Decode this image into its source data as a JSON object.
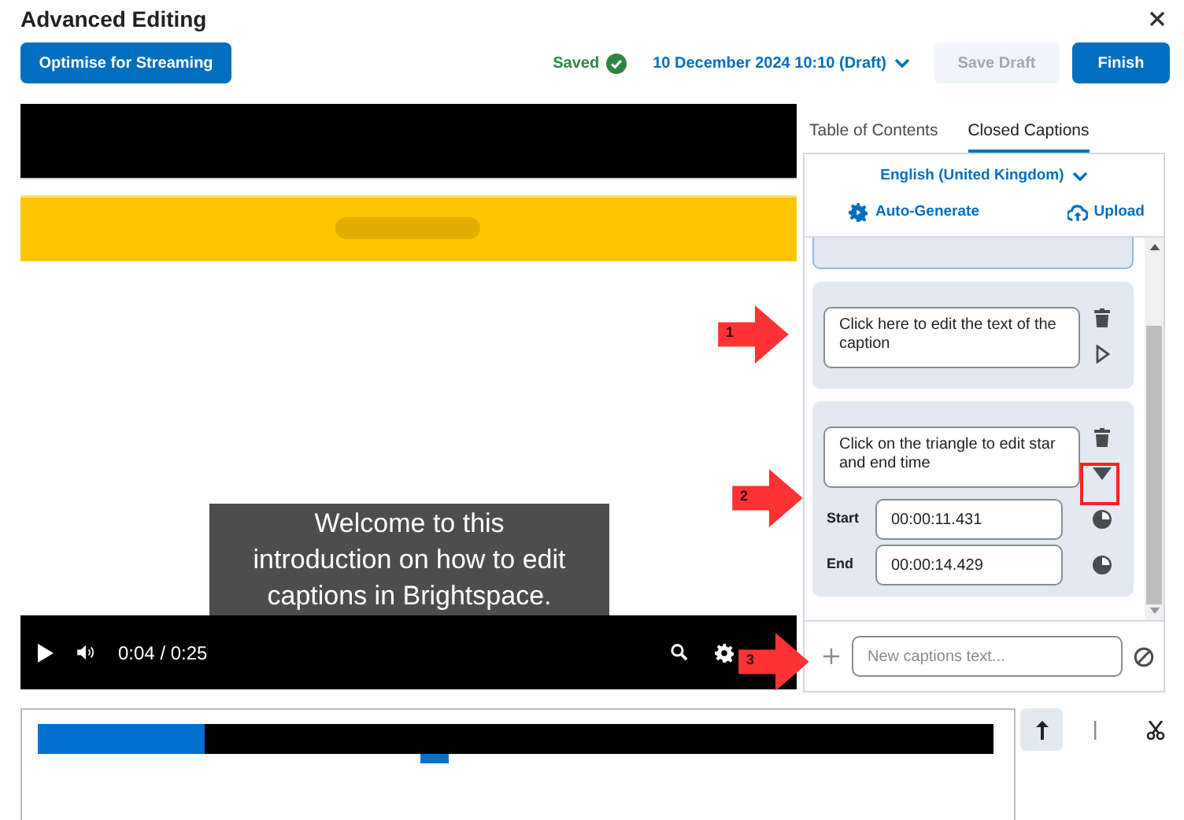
{
  "window": {
    "title": "Advanced Editing"
  },
  "toolbar": {
    "optimise_button": "Optimise for Streaming",
    "save_status": "Saved",
    "revision": "10 December 2024 10:10 (Draft)",
    "save_draft": {
      "label": "Save Draft",
      "disabled": true
    },
    "finish_button": "Finish"
  },
  "player": {
    "caption": "Welcome to this introduction on how to edit captions in Brightspace.",
    "time": "0:04 / 0:25"
  },
  "tabs": [
    {
      "label": "Table of Contents",
      "selected": false
    },
    {
      "label": "Closed Captions",
      "selected": true
    }
  ],
  "captions_panel": {
    "language": "English (United Kingdom)",
    "auto_generate": "Auto-Generate",
    "upload": "Upload",
    "cues": [
      {
        "lines": [
          "Click here to edit the text of the",
          "caption"
        ],
        "expanded": false
      },
      {
        "lines": [
          "Click on the triangle to edit star",
          "and end time"
        ],
        "expanded": true,
        "start_label": "Start",
        "start": "00:00:11.431",
        "end_label": "End",
        "end": "00:00:14.429"
      }
    ],
    "new_caption": {
      "placeholder": "New captions text..."
    }
  },
  "timeline": {
    "level": 0.175
  },
  "annotations": [
    {
      "number": "1"
    },
    {
      "number": "2"
    },
    {
      "number": "3"
    }
  ]
}
